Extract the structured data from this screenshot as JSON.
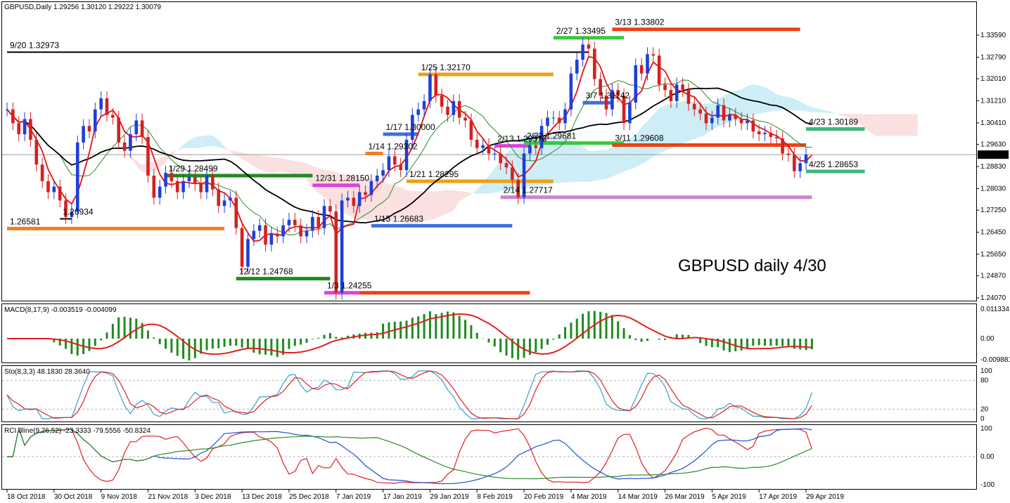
{
  "header": {
    "symbol_info": "GBPUSD,Daily  1.29256 1.30120 1.29222 1.30079"
  },
  "annotation_text": "GBPUSD daily 4/30",
  "current_price_label": "1.30079",
  "colors": {
    "bull": "#1f3fd6",
    "bear": "#d62020",
    "fast_ma": "#e81010",
    "slow_ma": "#000000",
    "mid_ma": "#2a8a2a",
    "cloud_bull": "#cdeef7",
    "cloud_bear": "#fbe0e0",
    "macd_hist": "#1e8c1e",
    "macd_signal": "#e02020",
    "sto_main": "#3aa0c8",
    "sto_signal": "#e02020",
    "rci_short": "#e02020",
    "rci_mid": "#2050d0",
    "rci_long": "#2a8a2a"
  },
  "chart_data": {
    "type": "candlestick",
    "symbol": "GBPUSD",
    "timeframe": "Daily",
    "price_axis_ticks": [
      "1.33590",
      "1.32790",
      "1.32010",
      "1.31210",
      "1.30410",
      "1.29630",
      "1.28830",
      "1.28030",
      "1.27250",
      "1.26450",
      "1.25650",
      "1.24870",
      "1.24070"
    ],
    "ylim": [
      1.2407,
      1.341
    ],
    "x_axis_labels": [
      "18 Oct 2018",
      "30 Oct 2018",
      "9 Nov 2018",
      "21 Nov 2018",
      "3 Dec 2018",
      "13 Dec 2018",
      "25 Dec 2018",
      "7 Jan 2019",
      "17 Jan 2019",
      "29 Jan 2019",
      "8 Feb 2019",
      "20 Feb 2019",
      "4 Mar 2019",
      "14 Mar 2019",
      "26 Mar 2019",
      "5 Apr 2019",
      "17 Apr 2019",
      "29 Apr 2019"
    ],
    "x_label_bars": [
      0,
      8,
      16,
      24,
      32,
      40,
      48,
      56,
      64,
      72,
      80,
      88,
      96,
      104,
      112,
      120,
      128,
      136
    ],
    "bar_count": 137,
    "closes": [
      1.309,
      1.304,
      1.3,
      1.3055,
      1.298,
      1.289,
      1.283,
      1.279,
      1.281,
      1.276,
      1.27,
      1.272,
      1.297,
      1.303,
      1.301,
      1.309,
      1.313,
      1.307,
      1.306,
      1.297,
      1.294,
      1.3,
      1.305,
      1.299,
      1.285,
      1.277,
      1.281,
      1.286,
      1.283,
      1.279,
      1.283,
      1.2845,
      1.282,
      1.279,
      1.285,
      1.28,
      1.274,
      1.276,
      1.277,
      1.266,
      1.252,
      1.262,
      1.265,
      1.267,
      1.26,
      1.264,
      1.263,
      1.267,
      1.269,
      1.267,
      1.263,
      1.265,
      1.27,
      1.266,
      1.274,
      1.272,
      1.2426,
      1.276,
      1.277,
      1.274,
      1.279,
      1.278,
      1.283,
      1.285,
      1.287,
      1.292,
      1.289,
      1.287,
      1.298,
      1.307,
      1.309,
      1.312,
      1.3217,
      1.314,
      1.31,
      1.307,
      1.312,
      1.306,
      1.305,
      1.298,
      1.295,
      1.296,
      1.293,
      1.293,
      1.2895,
      1.288,
      1.2835,
      1.2772,
      1.293,
      1.296,
      1.295,
      1.303,
      1.306,
      1.306,
      1.304,
      1.309,
      1.322,
      1.327,
      1.3325,
      1.331,
      1.32,
      1.314,
      1.309,
      1.316,
      1.314,
      1.304,
      1.3115,
      1.325,
      1.322,
      1.329,
      1.3285,
      1.318,
      1.316,
      1.312,
      1.318,
      1.316,
      1.311,
      1.309,
      1.3075,
      1.304,
      1.306,
      1.3105,
      1.305,
      1.307,
      1.3055,
      1.304,
      1.305,
      1.301,
      1.3,
      1.3005,
      1.299,
      1.2985,
      1.293,
      1.2925,
      1.2866,
      1.2895,
      1.2926,
      1.3008
    ],
    "levels": [
      {
        "label": "9/20 1.32973",
        "value": 1.32973,
        "color": "#000000",
        "x0": 0,
        "x1": 99
      },
      {
        "label": "3/13 1.33802",
        "value": 1.33802,
        "color": "#f04010",
        "x0": 103,
        "x1": 135
      },
      {
        "label": "2/27 1.33495",
        "value": 1.33495,
        "color": "#3cc83c",
        "x0": 93,
        "x1": 105
      },
      {
        "label": "1/25 1.32170",
        "value": 1.3217,
        "color": "#f0a010",
        "x0": 70,
        "x1": 93
      },
      {
        "label": "3/7 1.31142",
        "value": 1.31142,
        "color": "#4070e0",
        "x0": 98,
        "x1": 103
      },
      {
        "label": "4/23 1.30189",
        "value": 1.30189,
        "color": "#3cb878",
        "x0": 136,
        "x1": 146
      },
      {
        "label": "2/13 1.29578",
        "value": 1.29578,
        "color": "#e040e0",
        "x0": 83,
        "x1": 89
      },
      {
        "label": "1/17 1.30000",
        "value": 1.3,
        "color": "#4070e0",
        "x0": 64,
        "x1": 70
      },
      {
        "label": "2/22 1.29681",
        "value": 1.29681,
        "color": "#3cc83c",
        "x0": 88,
        "x1": 105
      },
      {
        "label": "3/11 1.29608",
        "value": 1.29608,
        "color": "#f04010",
        "x0": 103,
        "x1": 136
      },
      {
        "label": "1/14 1.29302",
        "value": 1.29302,
        "color": "#f08020",
        "x0": 61,
        "x1": 64
      },
      {
        "label": "1/29 1.28499",
        "value": 1.28499,
        "color": "#208a20",
        "x0": 27,
        "x1": 52
      },
      {
        "label": "4/25 1.28653",
        "value": 1.28653,
        "color": "#3cb878",
        "x0": 136,
        "x1": 146
      },
      {
        "label": "1/21 1.28295",
        "value": 1.28295,
        "color": "#f0a010",
        "x0": 68,
        "x1": 93
      },
      {
        "label": "12/31 1.28150",
        "value": 1.2815,
        "color": "#e040e0",
        "x0": 52,
        "x1": 60
      },
      {
        "label": "2/14 1.27717",
        "value": 1.27717,
        "color": "#d080d0",
        "x0": 84,
        "x1": 137
      },
      {
        "label": "1.26934",
        "value": 1.26934,
        "color": "#000000",
        "x0": 9,
        "x1": 11
      },
      {
        "label": "1.26581",
        "value": 1.26581,
        "color": "#f08020",
        "x0": 0,
        "x1": 37
      },
      {
        "label": "1/15 1.26683",
        "value": 1.26683,
        "color": "#4070e0",
        "x0": 62,
        "x1": 86
      },
      {
        "label": "12/12 1.24768",
        "value": 1.24768,
        "color": "#208a20",
        "x0": 39,
        "x1": 55
      },
      {
        "label": "1/3 1.24255",
        "value": 1.24255,
        "color": "#e040e0",
        "x0": 54,
        "x1": 60
      },
      {
        "label": "1/3 1.24255 b",
        "value": 1.24255,
        "color": "#f04010",
        "x0": 60,
        "x1": 89
      }
    ],
    "indicators": {
      "macd": {
        "label": "MACD(8,17,9) -0.003519 -0.004099",
        "ticks": [
          "0.011334",
          "0.00",
          "-0.009881"
        ]
      },
      "sto": {
        "label": "Sto(8,3,3) 48.1830 28.3640",
        "ticks": [
          "100",
          "80",
          "20",
          "0"
        ]
      },
      "rci": {
        "label": "RCI 3line(9,26,52) -23.3333 -79.5556 -50.8324",
        "ticks": [
          "100",
          "0.00",
          "-100"
        ]
      }
    }
  }
}
